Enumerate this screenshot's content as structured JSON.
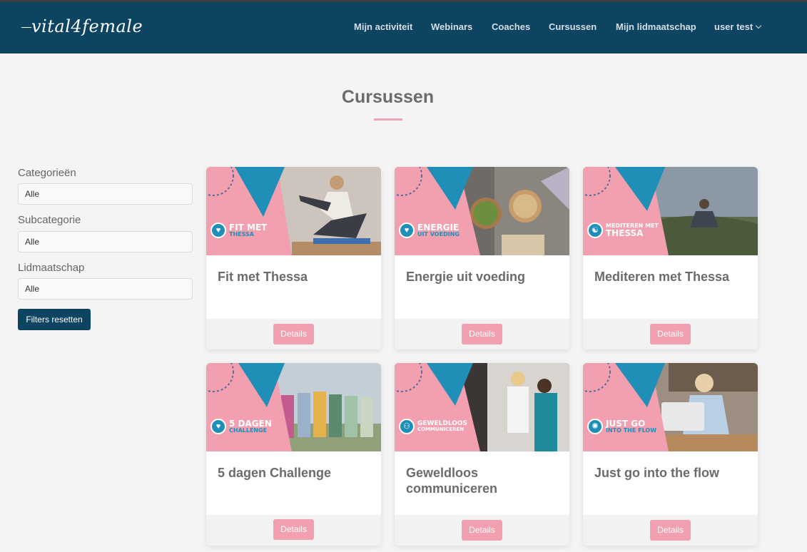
{
  "header": {
    "logo": "vital4female",
    "nav": [
      {
        "label": "Mijn activiteit"
      },
      {
        "label": "Webinars"
      },
      {
        "label": "Coaches"
      },
      {
        "label": "Cursussen"
      },
      {
        "label": "Mijn lidmaatschap"
      },
      {
        "label": "user test"
      }
    ]
  },
  "page": {
    "title": "Cursussen"
  },
  "filters": {
    "category_label": "Categorieën",
    "category_value": "Alle",
    "subcategory_label": "Subcategorie",
    "subcategory_value": "Alle",
    "membership_label": "Lidmaatschap",
    "membership_value": "Alle",
    "reset_label": "Filters resetten"
  },
  "courses": [
    {
      "title": "Fit met Thessa",
      "badge_line1": "FIT MET",
      "badge_line2": "THESSA",
      "details": "Details"
    },
    {
      "title": "Energie uit voeding",
      "badge_line1": "ENERGIE",
      "badge_line2": "UIT VOEDING",
      "details": "Details"
    },
    {
      "title": "Mediteren met Thessa",
      "badge_line1": "MEDITEREN MET",
      "badge_line2": "THESSA",
      "details": "Details"
    },
    {
      "title": "5 dagen Challenge",
      "badge_line1": "5 DAGEN",
      "badge_line2": "CHALLENGE",
      "details": "Details"
    },
    {
      "title": "Geweldloos communiceren",
      "badge_line1": "GEWELDLOOS",
      "badge_line2": "COMMUNICEREN",
      "details": "Details"
    },
    {
      "title": "Just go into the flow",
      "badge_line1": "JUST GO",
      "badge_line2": "INTO THE FLOW",
      "details": "Details"
    }
  ],
  "colors": {
    "header_bg": "#0d4461",
    "accent_pink": "#f29fb0",
    "accent_blue": "#1f8fb7"
  }
}
